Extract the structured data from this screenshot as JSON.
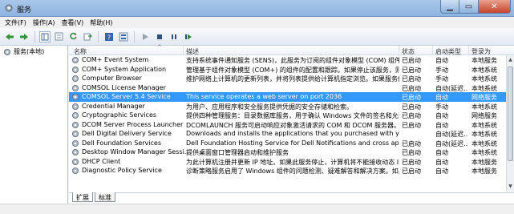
{
  "window": {
    "title": "服务",
    "min_glyph": "▁",
    "max_glyph": "▭",
    "close_glyph": "✕"
  },
  "menu": [
    "文件(F)",
    "操作(A)",
    "查看(V)",
    "帮助(H)"
  ],
  "tree": {
    "root_label": "服务(本地)"
  },
  "columns": {
    "name": "名称",
    "description": "描述",
    "state": "状态",
    "startup": "启动类型",
    "logon": "登录为"
  },
  "services": [
    {
      "name": "COM+ Event System",
      "description": "支持系统事件通知服务 (SENS)，此服务为订阅的组件对象模型 (COM) 组件提...",
      "state": "已启动",
      "startup": "自动",
      "logon": "本地服务",
      "selected": false
    },
    {
      "name": "COM+ System Application",
      "description": "管理基于组件对象模型 (COM+) 的组件的配置和跟踪。如果停止该服务，则大...",
      "state": "已启动",
      "startup": "手动",
      "logon": "本地系统",
      "selected": false
    },
    {
      "name": "Computer Browser",
      "description": "维护网络上计算机的更新列表，并将列表提供给计算机指定浏览。如果服务停止...",
      "state": "已启动",
      "startup": "手动",
      "logon": "本地系统",
      "selected": false
    },
    {
      "name": "COMSOL License Manager",
      "description": "",
      "state": "已启动",
      "startup": "自动(延迟...",
      "logon": "本地系统",
      "selected": false
    },
    {
      "name": "COMSOL Server 5.4 Service",
      "description": "This service operates a web server on port 2036",
      "state": "已启动",
      "startup": "自动",
      "logon": "网络服务",
      "selected": true
    },
    {
      "name": "Credential Manager",
      "description": "为用户、应用程序和安全服务提供凭据的安全存储和检索。",
      "state": "已启动",
      "startup": "手动",
      "logon": "本地系统",
      "selected": false
    },
    {
      "name": "Cryptographic Services",
      "description": "提供四种管理服务：目录数据库服务，用于确认 Windows 文件的签名和允许安...",
      "state": "已启动",
      "startup": "自动",
      "logon": "网络服务",
      "selected": false
    },
    {
      "name": "DCOM Server Process Launcher",
      "description": "DCOMLAUNCH 服务可启动响应对象激活请求的 COM 和 DCOM 服务器。如...",
      "state": "已启动",
      "startup": "自动",
      "logon": "本地系统",
      "selected": false
    },
    {
      "name": "Dell Digital Delivery Service",
      "description": "Downloads and installs the applications that you purchased with your c...",
      "state": "",
      "startup": "自动(延迟...",
      "logon": "本地系统",
      "selected": false
    },
    {
      "name": "Dell Foundation Services",
      "description": "Dell Foundation Hosting Service for Dell Notifications and cross applicat...",
      "state": "已启动",
      "startup": "自动(延迟...",
      "logon": "本地系统",
      "selected": false
    },
    {
      "name": "Desktop Window Manager Sessi...",
      "description": "提供桌面窗口管理器启动和维护服务",
      "state": "已启动",
      "startup": "自动",
      "logon": "本地系统",
      "selected": false
    },
    {
      "name": "DHCP Client",
      "description": "为此计算机注册并更新 IP 地址。如果此服务停止，计算机将不能接收动态 IP ...",
      "state": "已启动",
      "startup": "自动",
      "logon": "本地服务",
      "selected": false
    },
    {
      "name": "Diagnostic Policy Service",
      "description": "诊断策略服务启用了 Windows 组件的问题检测、疑难解答和解决方案。如果...",
      "state": "已启动",
      "startup": "自动",
      "logon": "本地服务",
      "selected": false
    }
  ],
  "tabs": [
    "扩展",
    "标准"
  ],
  "colors": {
    "selection": "#3399ff",
    "titlebar": "#a9c7ea"
  },
  "icons": [
    "services-app-icon",
    "back-arrow-icon",
    "forward-arrow-icon",
    "console-tree-icon",
    "list-icon",
    "refresh-icon",
    "export-icon",
    "help-icon",
    "properties-icon",
    "play-icon",
    "stop-icon",
    "pause-icon",
    "restart-icon",
    "gear-icon"
  ]
}
